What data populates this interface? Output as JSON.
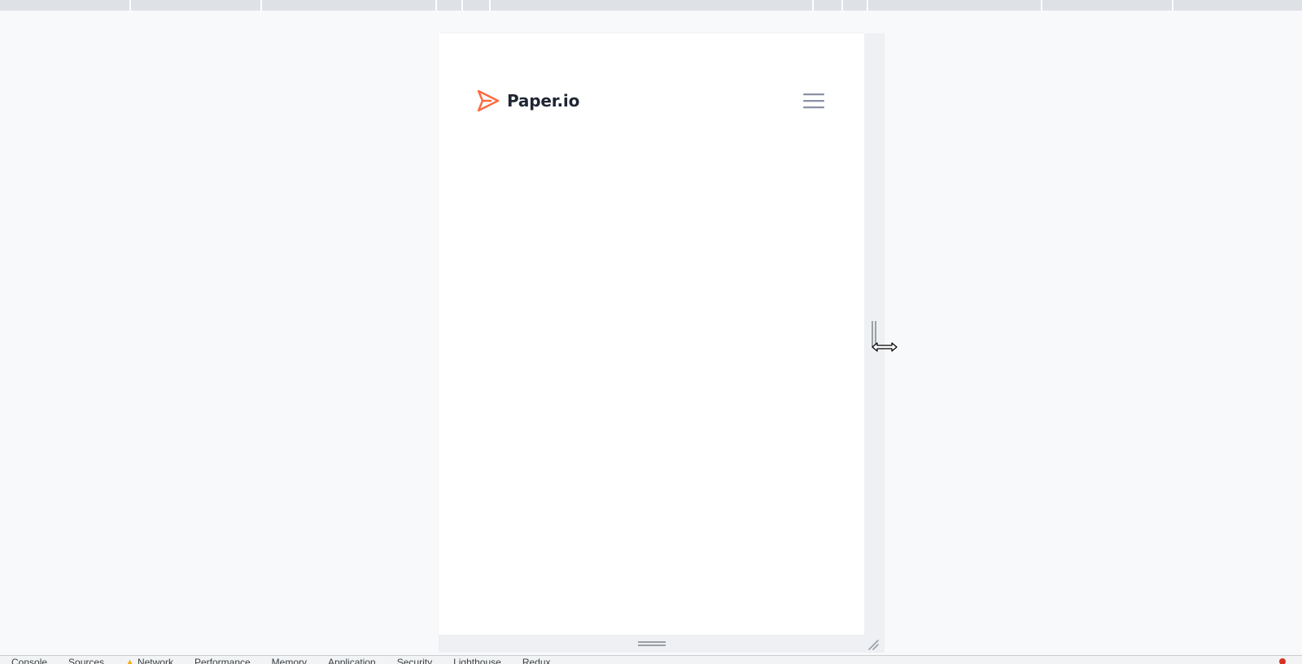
{
  "site": {
    "brand_name": "Paper.io"
  },
  "devtools": {
    "tabs": [
      {
        "label": "Console"
      },
      {
        "label": "Sources"
      },
      {
        "label": "Network",
        "warning": true
      },
      {
        "label": "Performance"
      },
      {
        "label": "Memory"
      },
      {
        "label": "Application"
      },
      {
        "label": "Security"
      },
      {
        "label": "Lighthouse"
      },
      {
        "label": "Redux"
      }
    ]
  },
  "colors": {
    "brand_accent": "#ff6a3d",
    "brand_text": "#1f2633",
    "menu_icon": "#8a90a6",
    "ruler": "#dee1e6",
    "handle": "#eef0f3",
    "error": "#d93025",
    "warning": "#f9ab00"
  },
  "icons": {
    "brand": "paper-plane-icon",
    "menu": "hamburger-menu-icon",
    "cursor": "resize-horizontal-cursor-icon"
  }
}
